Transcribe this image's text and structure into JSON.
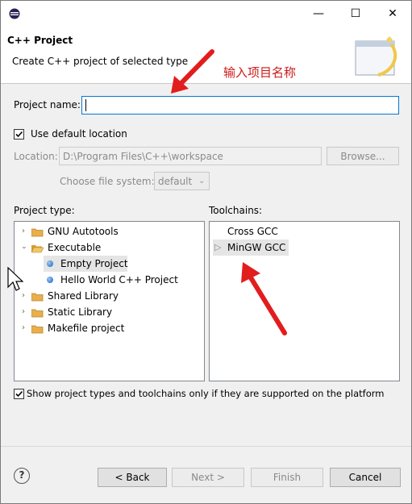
{
  "window": {
    "minimize": "—",
    "maximize": "☐",
    "close": "✕"
  },
  "header": {
    "title": "C++ Project",
    "subtitle": "Create C++ project of selected type"
  },
  "annotation": {
    "text": "输入项目名称",
    "color": "#cc1a1a"
  },
  "project_name": {
    "label": "Project name:",
    "value": ""
  },
  "default_location": {
    "label": "Use default location",
    "checked": true
  },
  "location": {
    "label": "Location:",
    "value": "D:\\Program Files\\C++\\workspace",
    "browse": "Browse..."
  },
  "file_system": {
    "label": "Choose file system:",
    "value": "default"
  },
  "project_type": {
    "label": "Project type:",
    "items": [
      {
        "label": "GNU Autotools",
        "kind": "folder",
        "expanded": false
      },
      {
        "label": "Executable",
        "kind": "folder",
        "expanded": true
      },
      {
        "label": "Empty Project",
        "kind": "item",
        "selected": true
      },
      {
        "label": "Hello World C++ Project",
        "kind": "item",
        "selected": false
      },
      {
        "label": "Shared Library",
        "kind": "folder",
        "expanded": false
      },
      {
        "label": "Static Library",
        "kind": "folder",
        "expanded": false
      },
      {
        "label": "Makefile project",
        "kind": "folder",
        "expanded": false
      }
    ]
  },
  "toolchains": {
    "label": "Toolchains:",
    "items": [
      {
        "label": "Cross GCC",
        "selected": false
      },
      {
        "label": "MinGW GCC",
        "selected": true
      }
    ]
  },
  "filter_checkbox": {
    "label": "Show project types and toolchains only if they are supported on the platform",
    "checked": true
  },
  "buttons": {
    "help": "?",
    "back": "< Back",
    "next": "Next >",
    "finish": "Finish",
    "cancel": "Cancel"
  },
  "colors": {
    "accent": "#0078d7",
    "selection": "#e5e5e5",
    "annotation": "#cc1a1a"
  }
}
